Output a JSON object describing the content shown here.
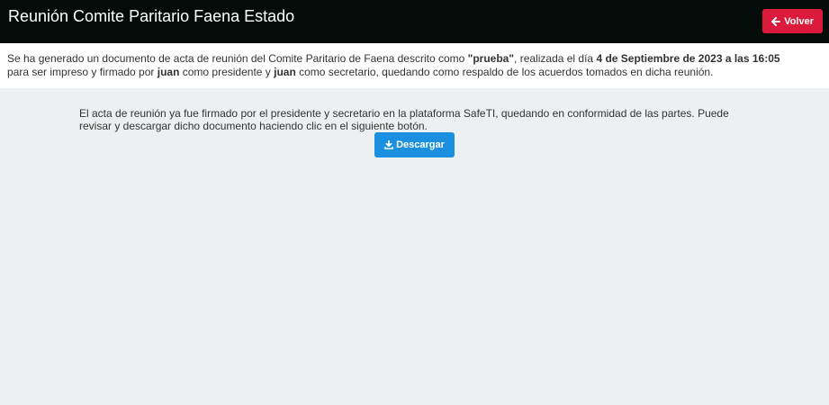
{
  "header": {
    "title": "Reunión Comite Paritario Faena Estado",
    "back_button": {
      "label": "Volver",
      "icon": "arrow-left-icon"
    }
  },
  "info": {
    "text_1": "Se ha generado un documento de acta de reunión del Comite Paritario de Faena descrito como ",
    "description": "\"prueba\"",
    "text_2": ", realizada el día ",
    "datetime": "4 de Septiembre de 2023 a las 16:05",
    "text_3": "para ser impreso y firmado por ",
    "president": "juan",
    "text_4": " como presidente y ",
    "secretary": "juan",
    "text_5": " como secretario, quedando como respaldo de los acuerdos tomados en dicha reunión."
  },
  "content": {
    "message": "El acta de reunión ya fue firmado por el presidente y secretario en la plataforma SafeTI, quedando en conformidad de las partes. Puede revisar y descargar dicho documento haciendo clic en el siguiente botón.",
    "download_button": {
      "label": "Descargar",
      "icon": "download-icon"
    }
  },
  "colors": {
    "header_bg": "#030c08",
    "back_button_bg": "#dc1b3c",
    "download_button_bg": "#1b8fe0",
    "page_bg": "#ecf0f1"
  }
}
